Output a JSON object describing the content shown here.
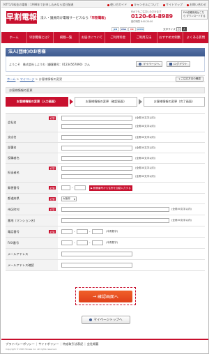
{
  "topbar": {
    "info": "NTT1/3料金の電報｜1998年でお申し込みなら翌日配達",
    "links": [
      "使い方ガイド",
      "キャンセルについて",
      "サイトマップ",
      "お問い合わせ"
    ]
  },
  "header": {
    "logo": "早割電報",
    "tagline_prefix": "法人・議員向け電報サービスなら",
    "tagline_brand": "「早割電報」",
    "fax_label": "FAXでもご注文いただけます",
    "phone": "0120-64-8989",
    "hours": "受付時間 8:00-20:00",
    "fax_button": "FAX依頼用紙はこちら ダウンロードする",
    "cards": [
      "JCB",
      "VISA",
      "MC",
      "AMEX"
    ],
    "fontsize_label": "文字サイズ",
    "fontsize_small": "小",
    "fontsize_large": "大"
  },
  "nav": [
    "ホーム",
    "早割電報とは？",
    "掲載一覧",
    "お届けについて",
    "ご利用料金",
    "ご利用方法",
    "おすすめ文例集",
    "よくある質問"
  ],
  "member": {
    "title": "法人(団体)のお客様",
    "welcome": "ようこそ　株式会社しようわ（顧客番号：01234567890）さん",
    "mypage_btn": "マイページへ",
    "logout_btn": "ログアウト"
  },
  "breadcrumb": {
    "home": "ホーム",
    "mypage": "マイページ",
    "current": "お客様情報の変更",
    "sep": " > "
  },
  "help_btn": "ご注文方法の確認",
  "section_title": "お客様情報の変更",
  "steps": [
    "お客様情報の変更（入力画面）",
    "お客様情報の変更（確認画面）",
    "お客様情報の変更（完了画面）"
  ],
  "form": {
    "req": "必須",
    "fields": [
      {
        "label": "会社名",
        "note": "(全角30文字以内)",
        "note2": "(全角30文字以内)"
      },
      {
        "label": "支店名",
        "note": "(全角30文字以内)"
      },
      {
        "label": "部署名",
        "note": "(全角30文字以内)"
      },
      {
        "label": "役職者名",
        "note": "(全角30文字以内)"
      },
      {
        "label": "担当者名",
        "note": "(全角30文字以内)",
        "note2": "(全角30文字以内)"
      },
      {
        "label": "郵便番号",
        "zip_btn": "郵便番号から住所を自動入力する"
      },
      {
        "label": "都道府県",
        "select": "大阪府"
      },
      {
        "label": "市区町村",
        "note": "(全角50文字以内)"
      },
      {
        "label": "番地（マンション名）",
        "note": "(全角50文字以内)"
      },
      {
        "label": "電話番号",
        "note": "(半角数字)"
      },
      {
        "label": "FAX番号",
        "note": "(半角数字)"
      },
      {
        "label": "メールアドレス"
      },
      {
        "label": "メールアドレス確認"
      }
    ]
  },
  "buttons": {
    "confirm": "確認画面へ",
    "mypage_top": "マイページトップへ"
  },
  "footer": {
    "links": [
      "プライバシーポリシー",
      "サイトポリシー",
      "特定取引法表記",
      "会社概要"
    ],
    "copyright": "Copyright © 2009 Showa inc. All rights reserved."
  },
  "colors": {
    "brand_red": "#c8102e",
    "member_blue": "#3d5a8f",
    "confirm_orange": "#e0401a"
  }
}
